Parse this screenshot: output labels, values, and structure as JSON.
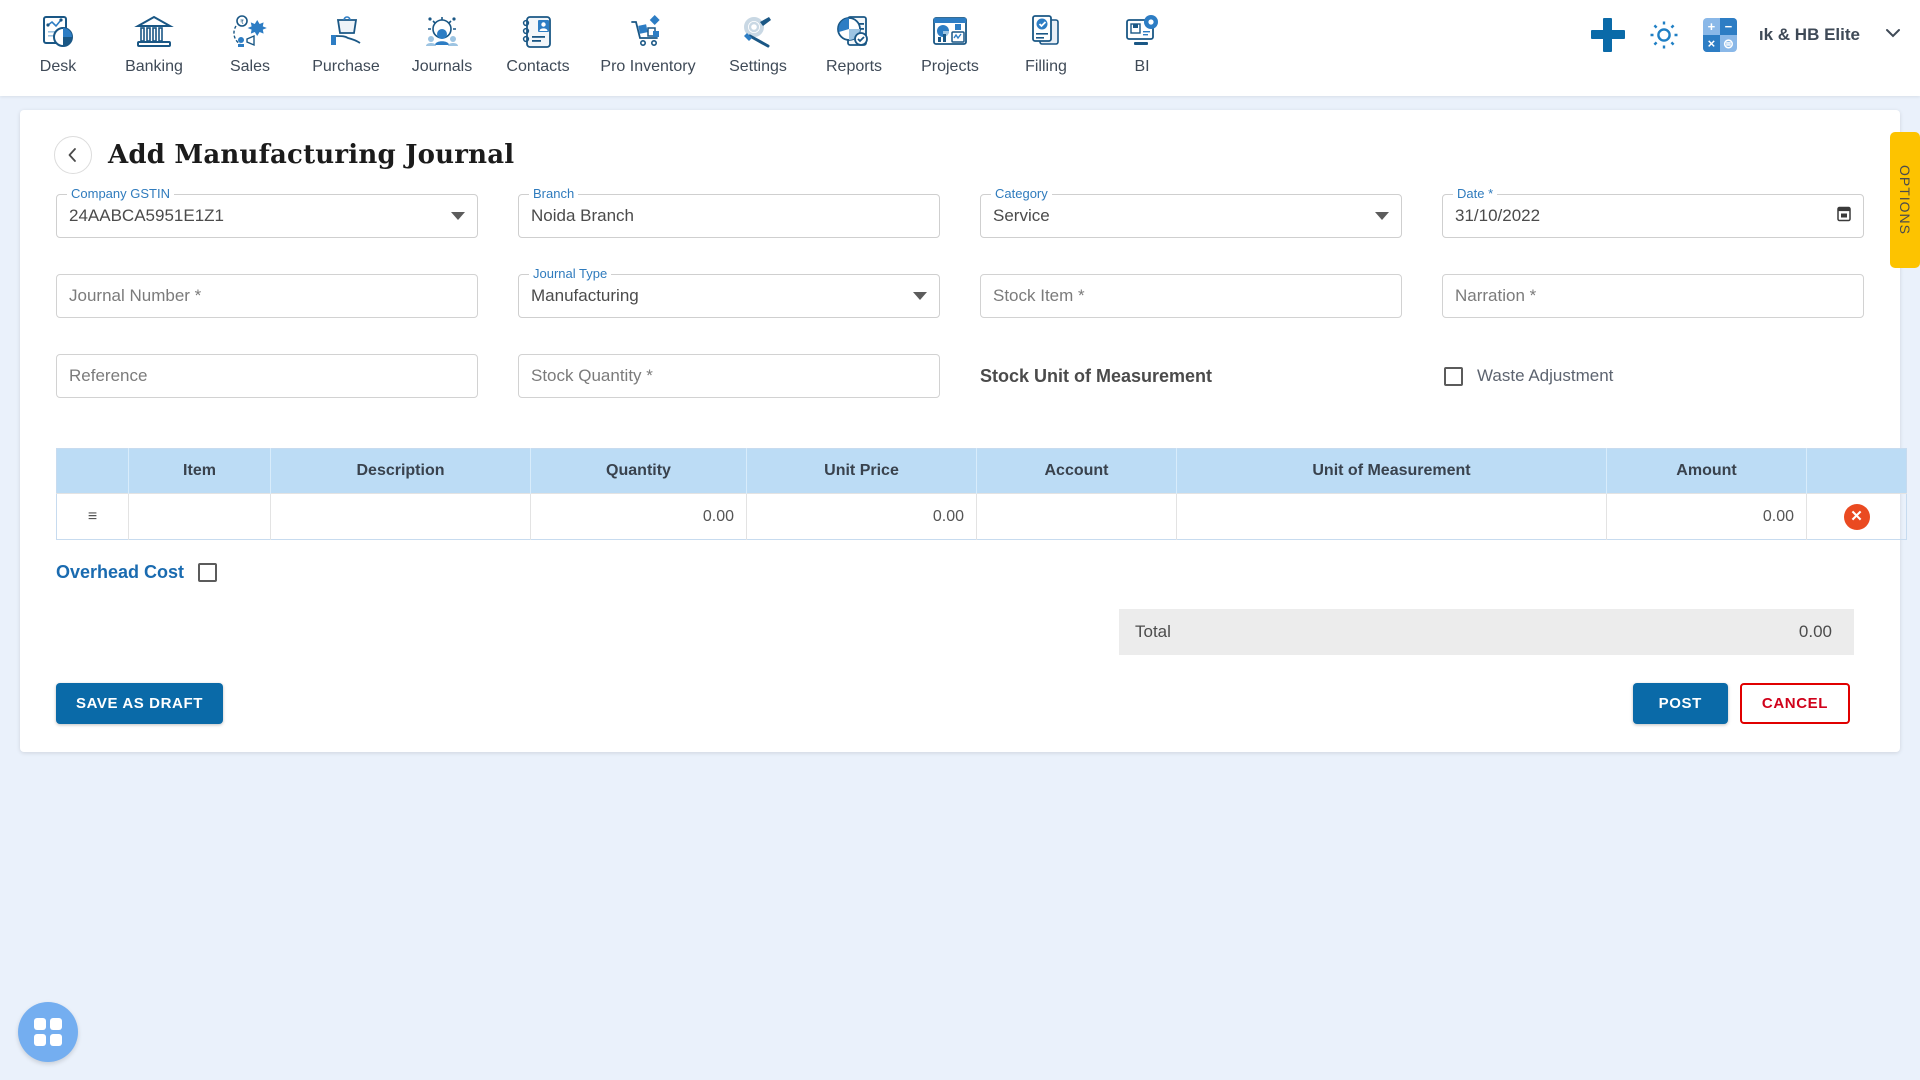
{
  "nav": {
    "items": [
      {
        "label": "Desk",
        "icon": "dashboard-icon"
      },
      {
        "label": "Banking",
        "icon": "bank-icon"
      },
      {
        "label": "Sales",
        "icon": "sales-icon"
      },
      {
        "label": "Purchase",
        "icon": "purchase-icon"
      },
      {
        "label": "Journals",
        "icon": "journals-icon"
      },
      {
        "label": "Contacts",
        "icon": "contacts-icon"
      },
      {
        "label": "Pro Inventory",
        "icon": "inventory-icon"
      },
      {
        "label": "Settings",
        "icon": "settings-icon"
      },
      {
        "label": "Reports",
        "icon": "reports-icon"
      },
      {
        "label": "Projects",
        "icon": "projects-icon"
      },
      {
        "label": "Filling",
        "icon": "filling-icon"
      },
      {
        "label": "BI",
        "icon": "bi-icon"
      }
    ]
  },
  "header": {
    "add_icon": "plus-icon",
    "settings_icon": "gear-icon",
    "calculator_icon": "calculator-icon",
    "org_name": "ık & HB Elite",
    "dropdown_icon": "chevron-down-icon"
  },
  "page": {
    "title": "Add Manufacturing Journal",
    "back_icon": "chevron-left-icon",
    "options_tab": "OPTIONS"
  },
  "form": {
    "company_gstin": {
      "label": "Company GSTIN",
      "value": "24AABCA5951E1Z1"
    },
    "branch": {
      "label": "Branch",
      "value": "Noida Branch"
    },
    "category": {
      "label": "Category",
      "value": "Service"
    },
    "date": {
      "label": "Date *",
      "value": "31/10/2022"
    },
    "journal_number": {
      "placeholder": "Journal Number *",
      "value": ""
    },
    "journal_type": {
      "label": "Journal Type",
      "value": "Manufacturing"
    },
    "stock_item": {
      "placeholder": "Stock Item *",
      "value": ""
    },
    "narration": {
      "placeholder": "Narration *",
      "value": ""
    },
    "reference": {
      "placeholder": "Reference",
      "value": ""
    },
    "stock_quantity": {
      "placeholder": "Stock Quantity *",
      "value": ""
    },
    "stock_uom_label": "Stock Unit of Measurement",
    "waste_adjustment": {
      "label": "Waste Adjustment",
      "checked": false
    }
  },
  "table": {
    "columns": [
      "",
      "Item",
      "Description",
      "Quantity",
      "Unit Price",
      "Account",
      "Unit of Measurement",
      "Amount",
      ""
    ],
    "rows": [
      {
        "handle": "≡",
        "item": "",
        "description": "",
        "quantity": "0.00",
        "unit_price": "0.00",
        "account": "",
        "uom": "",
        "amount": "0.00",
        "delete": "✕"
      }
    ]
  },
  "overhead": {
    "label": "Overhead Cost",
    "checked": false
  },
  "total": {
    "label": "Total",
    "value": "0.00"
  },
  "buttons": {
    "save_as_draft": "SAVE AS DRAFT",
    "post": "POST",
    "cancel": "CANCEL"
  },
  "fab": {
    "icon": "apps-grid-icon"
  },
  "colors": {
    "accent": "#0a6aa8",
    "label": "#2f7bbd",
    "table_header": "#bcdcf5",
    "options_tab": "#fdc300",
    "danger": "#e00000",
    "delete": "#ea4a21",
    "page_bg": "#eaf1fb"
  }
}
